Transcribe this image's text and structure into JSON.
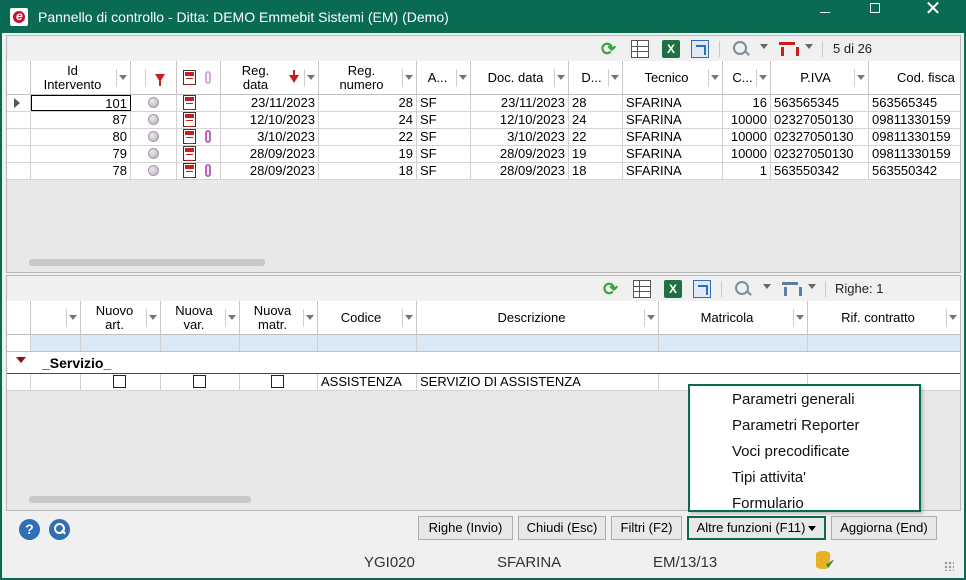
{
  "window": {
    "title": "Pannello di controllo - Ditta: DEMO Emmebit Sistemi (EM)  (Demo)",
    "icon": "app-logo-icon"
  },
  "top_toolbar": {
    "count": "5 di 26"
  },
  "top_grid": {
    "columns": [
      "Id\nIntervento",
      "Reg.\ndata",
      "Reg.\nnumero",
      "A...",
      "Doc. data",
      "D...",
      "Tecnico",
      "C...",
      "P.IVA",
      "Cod. fisca"
    ],
    "rows": [
      {
        "id": "101",
        "reg_data": "23/11/2023",
        "reg_num": "28",
        "a": "SF",
        "doc_data": "23/11/2023",
        "d": "28",
        "tecnico": "SFARINA",
        "c": "16",
        "piva": "563565345",
        "codfisc": "563565345",
        "clip": false
      },
      {
        "id": "87",
        "reg_data": "12/10/2023",
        "reg_num": "24",
        "a": "SF",
        "doc_data": "12/10/2023",
        "d": "24",
        "tecnico": "SFARINA",
        "c": "10000",
        "piva": "02327050130",
        "codfisc": "09811330159",
        "clip": false
      },
      {
        "id": "80",
        "reg_data": "3/10/2023",
        "reg_num": "22",
        "a": "SF",
        "doc_data": "3/10/2023",
        "d": "22",
        "tecnico": "SFARINA",
        "c": "10000",
        "piva": "02327050130",
        "codfisc": "09811330159",
        "clip": true
      },
      {
        "id": "79",
        "reg_data": "28/09/2023",
        "reg_num": "19",
        "a": "SF",
        "doc_data": "28/09/2023",
        "d": "19",
        "tecnico": "SFARINA",
        "c": "10000",
        "piva": "02327050130",
        "codfisc": "09811330159",
        "clip": false
      },
      {
        "id": "78",
        "reg_data": "28/09/2023",
        "reg_num": "18",
        "a": "SF",
        "doc_data": "28/09/2023",
        "d": "18",
        "tecnico": "SFARINA",
        "c": "1",
        "piva": "563550342",
        "codfisc": "563550342",
        "clip": true
      }
    ]
  },
  "bottom_toolbar": {
    "count": "Righe: 1"
  },
  "bottom_grid": {
    "columns": [
      "Nuovo\nart.",
      "Nuova\nvar.",
      "Nuova\nmatr.",
      "Codice",
      "Descrizione",
      "Matricola",
      "Rif. contratto"
    ],
    "group_label": "_Servizio_",
    "rows": [
      {
        "codice": "ASSISTENZA",
        "descrizione": "SERVIZIO DI ASSISTENZA",
        "matricola": "",
        "rif": ""
      }
    ]
  },
  "menu": {
    "items": [
      "Parametri generali",
      "Parametri Reporter",
      "Voci precodificate",
      "Tipi attivita'",
      "Formulario"
    ]
  },
  "buttons": {
    "righe": "Righe (Invio)",
    "chiudi": "Chiudi (Esc)",
    "filtri": "Filtri (F2)",
    "altre": "Altre funzioni (F11)",
    "aggiorna": "Aggiorna (End)"
  },
  "status": {
    "code": "YGI020",
    "user": "SFARINA",
    "ref": "EM/13/13"
  },
  "colors": {
    "accent": "#0a6b55",
    "filter_red": "#c81e1e",
    "excel_green": "#1d7145"
  }
}
